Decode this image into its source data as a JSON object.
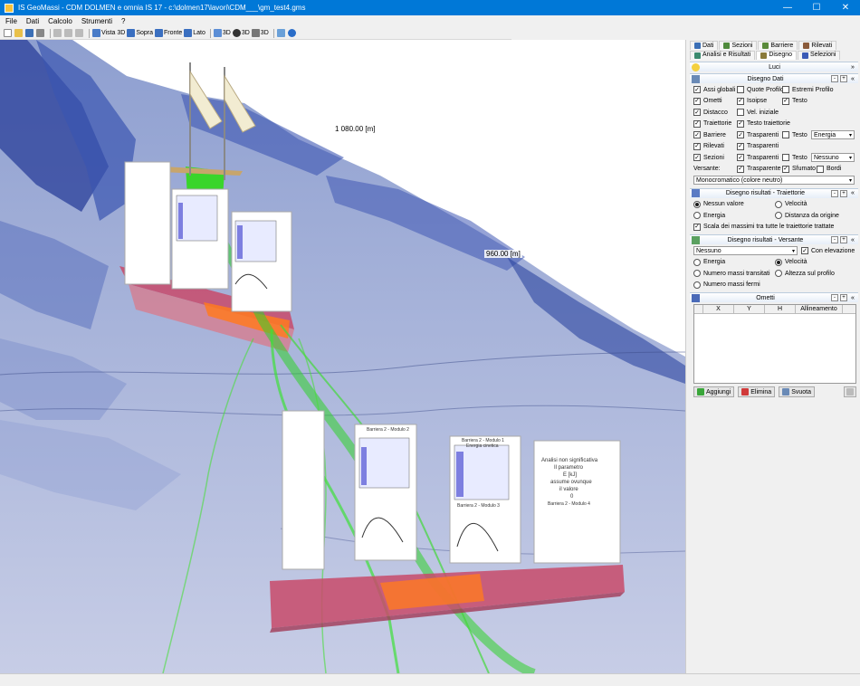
{
  "window": {
    "title": "IS GeoMassi - CDM DOLMEN e omnia IS 17 - c:\\dolmen17\\lavori\\CDM___\\gm_test4.gms",
    "minimize": "—",
    "maximize": "☐",
    "close": "✕"
  },
  "menu": [
    "File",
    "Dati",
    "Calcolo",
    "Strumenti",
    "?"
  ],
  "toolbar": {
    "vista3d": "Vista 3D",
    "sopra": "Sopra",
    "fronte": "Fronte",
    "lato": "Lato",
    "b3d_a": "3D",
    "b3d_b": "3D",
    "b3d_c": "3D"
  },
  "viewport": {
    "label_upper": "1 080.00 [m]",
    "label_lower": "960.00 [m]",
    "panel_texts": {
      "barrier_title": "Barriera 2 - Modulo 1",
      "energy": "Energia cinetica",
      "barrier_title2": "Barriera 2 - Modulo 2",
      "barrier_title3": "Barriera 2 - Modulo 3",
      "barrier_title4": "Barriera 2 - Modulo 4",
      "analysis": "Analisi non significativa",
      "analysis_note": "Il parametro",
      "analysis_note2": "E [kJ]",
      "analysis_note3": "assume ovunque",
      "analysis_note4": "il valore",
      "analysis_zero": "0"
    }
  },
  "panel": {
    "tabs_row1": [
      "Dati",
      "Sezioni",
      "Barriere",
      "Rilevati"
    ],
    "tabs_row2": [
      "Analisi e Risultati",
      "Disegno",
      "Selezioni"
    ],
    "selected_tab": "Disegno",
    "luci": {
      "title": "Luci"
    },
    "disegno_dati": {
      "title": "Disegno Dati",
      "rows": [
        [
          {
            "label": "Assi globali",
            "checked": true
          },
          {
            "label": "Quote Profilo",
            "checked": false
          },
          {
            "label": "Estremi Profilo",
            "checked": false
          }
        ],
        [
          {
            "label": "Ometti",
            "checked": true
          },
          {
            "label": "Isoipse",
            "checked": true
          },
          {
            "label": "Testo",
            "checked": true
          }
        ],
        [
          {
            "label": "Distacco",
            "checked": true
          },
          {
            "label": "Vel. iniziale",
            "checked": false
          }
        ],
        [
          {
            "label": "Traiettorie",
            "checked": true
          },
          {
            "label": "Testo traiettorie",
            "checked": true
          }
        ],
        [
          {
            "label": "Barriere",
            "checked": true
          },
          {
            "label": "Trasparenti",
            "checked": true
          },
          {
            "label": "Testo",
            "checked": false
          }
        ],
        [
          {
            "label": "Rilevati",
            "checked": true
          },
          {
            "label": "Trasparenti",
            "checked": true
          }
        ],
        [
          {
            "label": "Sezioni",
            "checked": true
          },
          {
            "label": "Trasparenti",
            "checked": true
          },
          {
            "label": "Testo",
            "checked": false
          }
        ]
      ],
      "barriere_select": "Energia",
      "sezioni_select": "Nessuno",
      "versante_label": "Versante:",
      "versante_opts": [
        {
          "label": "Trasparente",
          "checked": true
        },
        {
          "label": "Sfumato",
          "checked": true
        },
        {
          "label": "Bordi",
          "checked": false
        }
      ],
      "colore_select": "Monocromatico (colore neutro)"
    },
    "traiettorie": {
      "title": "Disegno risultati - Traiettorie",
      "nessun_valore": "Nessun valore",
      "velocita": "Velocità",
      "energia": "Energia",
      "distanza": "Distanza da origine",
      "scala": "Scala dei massimi tra tutte le traiettorie trattate"
    },
    "versante": {
      "title": "Disegno risultati - Versante",
      "select": "Nessuno",
      "con_elevazione": "Con elevazione",
      "energia": "Energia",
      "velocita": "Velocità",
      "transitati": "Numero massi transitati",
      "altezza": "Altezza sul profilo",
      "fermi": "Numero massi fermi"
    },
    "ometti": {
      "title": "Ometti",
      "cols": [
        "X",
        "Y",
        "H",
        "Allineamento"
      ],
      "aggiungi": "Aggiungi",
      "elimina": "Elimina",
      "svuota": "Svuota"
    }
  }
}
